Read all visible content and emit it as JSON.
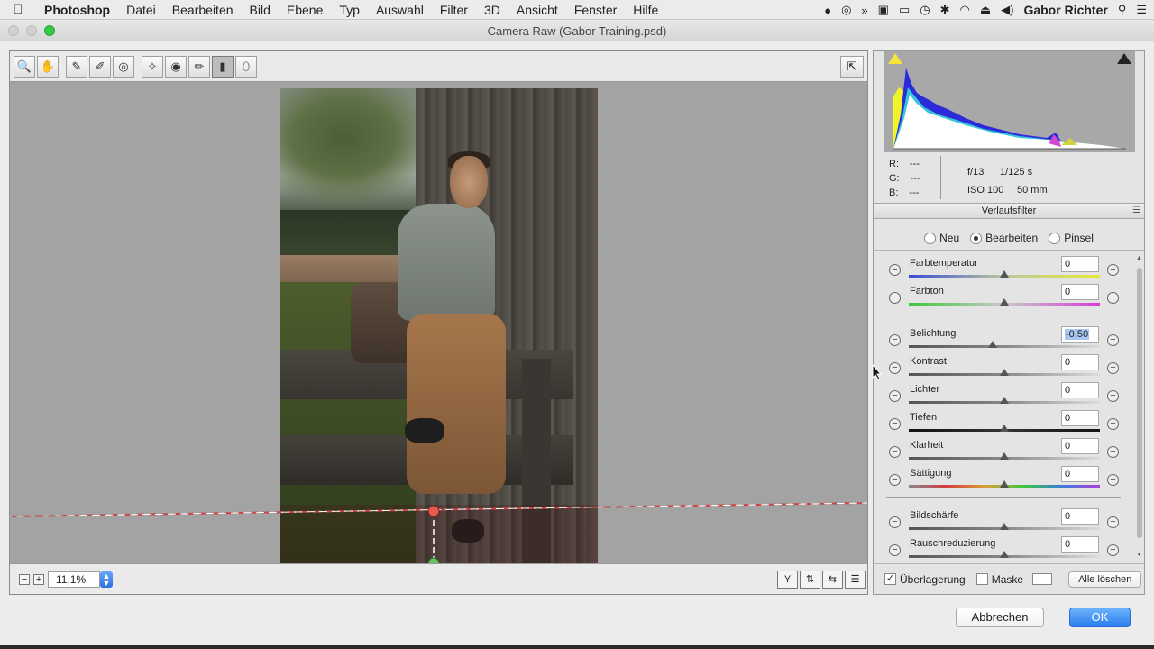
{
  "menubar": {
    "app_name": "Photoshop",
    "menus": [
      "Datei",
      "Bearbeiten",
      "Bild",
      "Ebene",
      "Typ",
      "Auswahl",
      "Filter",
      "3D",
      "Ansicht",
      "Fenster",
      "Hilfe"
    ],
    "user_name": "Gabor Richter"
  },
  "window": {
    "title": "Camera Raw (Gabor Training.psd)"
  },
  "preview": {
    "zoom_value": "11,1%",
    "zoom_out_label": "−",
    "zoom_in_label": "+"
  },
  "toolbar": {
    "tools": [
      {
        "name": "zoom-tool",
        "icon": "magnifier-icon",
        "glyph": "🔍"
      },
      {
        "name": "hand-tool",
        "icon": "hand-icon",
        "glyph": "✋"
      },
      {
        "name": "white-balance-tool",
        "icon": "eyedropper-icon",
        "glyph": "✎"
      },
      {
        "name": "color-sampler-tool",
        "icon": "eyedropper-plus-icon",
        "glyph": "✐"
      },
      {
        "name": "target-adjust-tool",
        "icon": "target-icon",
        "glyph": "◎"
      },
      {
        "name": "spot-removal-tool",
        "icon": "brush-spot-icon",
        "glyph": "✧"
      },
      {
        "name": "red-eye-tool",
        "icon": "eye-icon",
        "glyph": "◉"
      },
      {
        "name": "adjustment-brush-tool",
        "icon": "brush-icon",
        "glyph": "✏"
      },
      {
        "name": "graduated-filter-tool",
        "icon": "graduated-filter-icon",
        "glyph": "▮",
        "active": true
      },
      {
        "name": "radial-filter-tool",
        "icon": "radial-filter-icon",
        "glyph": "⬯"
      }
    ]
  },
  "histogram": {
    "info": {
      "r_label": "R:",
      "r_value": "---",
      "g_label": "G:",
      "g_value": "---",
      "b_label": "B:",
      "b_value": "---",
      "aperture": "f/13",
      "shutter": "1/125 s",
      "iso": "ISO 100",
      "focal": "50 mm"
    }
  },
  "panel": {
    "title": "Verlaufsfilter",
    "modes": [
      {
        "label": "Neu",
        "selected": false
      },
      {
        "label": "Bearbeiten",
        "selected": true
      },
      {
        "label": "Pinsel",
        "selected": false
      }
    ],
    "sliders": [
      {
        "label": "Farbtemperatur",
        "value": "0",
        "position": 0.5,
        "track": "temp"
      },
      {
        "label": "Farbton",
        "value": "0",
        "position": 0.5,
        "track": "tint"
      },
      {
        "label": "Belichtung",
        "value": "-0,50",
        "position": 0.44,
        "track": "gray",
        "selected": true
      },
      {
        "label": "Kontrast",
        "value": "0",
        "position": 0.5,
        "track": "gray"
      },
      {
        "label": "Lichter",
        "value": "0",
        "position": 0.5,
        "track": "gray"
      },
      {
        "label": "Tiefen",
        "value": "0",
        "position": 0.5,
        "track": "dark"
      },
      {
        "label": "Klarheit",
        "value": "0",
        "position": 0.5,
        "track": "gray"
      },
      {
        "label": "Sättigung",
        "value": "0",
        "position": 0.5,
        "track": "sat"
      },
      {
        "label": "Bildschärfe",
        "value": "0",
        "position": 0.5,
        "track": "gray"
      },
      {
        "label": "Rauschreduzierung",
        "value": "0",
        "position": 0.5,
        "track": "gray"
      }
    ],
    "overlay_label": "Überlagerung",
    "overlay_checked": true,
    "mask_label": "Maske",
    "mask_checked": false,
    "clear_all_label": "Alle löschen"
  },
  "dialog": {
    "cancel_label": "Abbrechen",
    "ok_label": "OK"
  }
}
